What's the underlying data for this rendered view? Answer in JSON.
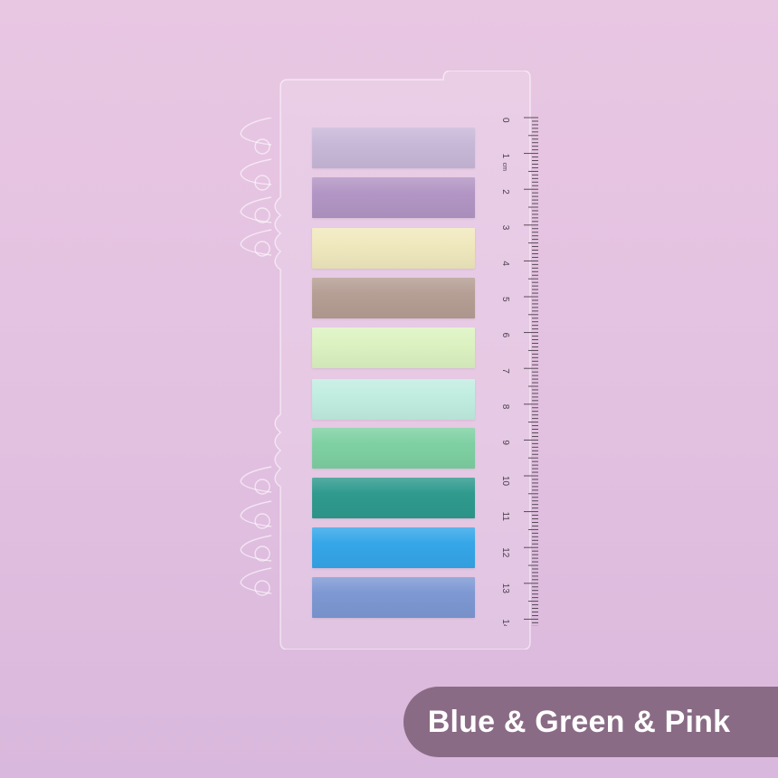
{
  "image": {
    "background_color": "#e6c5e2",
    "subject": "sticky-index-tabs-on-ruler-card",
    "tab_colors": [
      "#c8b8d8",
      "#b295c4",
      "#f0e8bd",
      "#b59e94",
      "#dcf2c1",
      "#c1ede1",
      "#7ed0a2",
      "#2f9a8e",
      "#35a6e8",
      "#7d98d3"
    ],
    "ruler_numbers": [
      "0",
      "1",
      "2",
      "3",
      "4",
      "5",
      "6",
      "7",
      "8",
      "9",
      "10",
      "11",
      "12",
      "13",
      "14"
    ],
    "ruler_unit": "cm"
  },
  "caption": {
    "text": "Blue & Green & Pink",
    "badge_color": "#8a6b85"
  }
}
